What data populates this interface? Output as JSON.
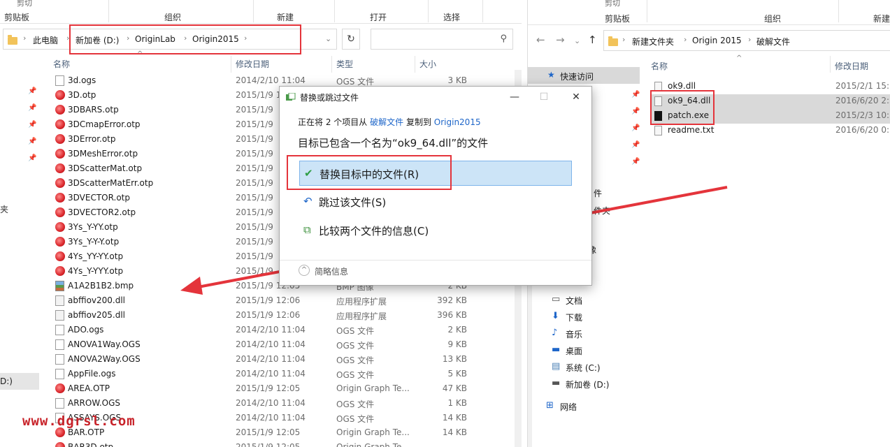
{
  "left": {
    "ribbon": {
      "cut_top": "剪切",
      "groups": [
        "剪贴板",
        "组织",
        "新建",
        "打开",
        "选择"
      ]
    },
    "breadcrumb": [
      "此电脑",
      "新加卷 (D:)",
      "OriginLab",
      "Origin2015"
    ],
    "columns": {
      "name": "名称",
      "date": "修改日期",
      "type": "类型",
      "size": "大小"
    },
    "files": [
      {
        "name": "3d.ogs",
        "date": "2014/2/10 11:04",
        "type": "OGS 文件",
        "size": "3 KB",
        "icon": "doc"
      },
      {
        "name": "3D.otp",
        "date": "2015/1/9 12:05",
        "type": "",
        "size": "",
        "icon": "origin"
      },
      {
        "name": "3DBARS.otp",
        "date": "2015/1/9",
        "type": "",
        "size": "",
        "icon": "origin"
      },
      {
        "name": "3DCmapError.otp",
        "date": "2015/1/9",
        "type": "",
        "size": "",
        "icon": "origin"
      },
      {
        "name": "3DError.otp",
        "date": "2015/1/9",
        "type": "",
        "size": "",
        "icon": "origin"
      },
      {
        "name": "3DMeshError.otp",
        "date": "2015/1/9",
        "type": "",
        "size": "",
        "icon": "origin"
      },
      {
        "name": "3DScatterMat.otp",
        "date": "2015/1/9",
        "type": "",
        "size": "",
        "icon": "origin"
      },
      {
        "name": "3DScatterMatErr.otp",
        "date": "2015/1/9",
        "type": "",
        "size": "",
        "icon": "origin"
      },
      {
        "name": "3DVECTOR.otp",
        "date": "2015/1/9",
        "type": "",
        "size": "",
        "icon": "origin"
      },
      {
        "name": "3DVECTOR2.otp",
        "date": "2015/1/9",
        "type": "",
        "size": "",
        "icon": "origin"
      },
      {
        "name": "3Ys_Y-YY.otp",
        "date": "2015/1/9",
        "type": "",
        "size": "",
        "icon": "origin"
      },
      {
        "name": "3Ys_Y-Y-Y.otp",
        "date": "2015/1/9",
        "type": "",
        "size": "",
        "icon": "origin"
      },
      {
        "name": "4Ys_YY-YY.otp",
        "date": "2015/1/9",
        "type": "",
        "size": "",
        "icon": "origin"
      },
      {
        "name": "4Ys_Y-YYY.otp",
        "date": "2015/1/9",
        "type": "",
        "size": "",
        "icon": "origin"
      },
      {
        "name": "A1A2B1B2.bmp",
        "date": "2015/1/9 12:05",
        "type": "BMP 图像",
        "size": "2 KB",
        "icon": "bmp"
      },
      {
        "name": "abffiov200.dll",
        "date": "2015/1/9 12:06",
        "type": "应用程序扩展",
        "size": "392 KB",
        "icon": "dll"
      },
      {
        "name": "abffiov205.dll",
        "date": "2015/1/9 12:06",
        "type": "应用程序扩展",
        "size": "396 KB",
        "icon": "dll"
      },
      {
        "name": "ADO.ogs",
        "date": "2014/2/10 11:04",
        "type": "OGS 文件",
        "size": "2 KB",
        "icon": "doc"
      },
      {
        "name": "ANOVA1Way.OGS",
        "date": "2014/2/10 11:04",
        "type": "OGS 文件",
        "size": "9 KB",
        "icon": "doc"
      },
      {
        "name": "ANOVA2Way.OGS",
        "date": "2014/2/10 11:04",
        "type": "OGS 文件",
        "size": "13 KB",
        "icon": "doc"
      },
      {
        "name": "AppFile.ogs",
        "date": "2014/2/10 11:04",
        "type": "OGS 文件",
        "size": "5 KB",
        "icon": "doc"
      },
      {
        "name": "AREA.OTP",
        "date": "2015/1/9 12:05",
        "type": "Origin Graph Te...",
        "size": "47 KB",
        "icon": "origin"
      },
      {
        "name": "ARROW.OGS",
        "date": "2014/2/10 11:04",
        "type": "OGS 文件",
        "size": "1 KB",
        "icon": "doc"
      },
      {
        "name": "ASSAYS.OGS",
        "date": "2014/2/10 11:04",
        "type": "OGS 文件",
        "size": "14 KB",
        "icon": "doc"
      },
      {
        "name": "BAR.OTP",
        "date": "2015/1/9 12:05",
        "type": "Origin Graph Te...",
        "size": "14 KB",
        "icon": "origin"
      },
      {
        "name": "BAR3D.otp",
        "date": "2015/1/9 12:05",
        "type": "Origin Graph Te...",
        "size": "",
        "icon": "origin"
      }
    ],
    "side": {
      "folder_partial": "夹",
      "drive_partial": "D:)"
    }
  },
  "right": {
    "ribbon": {
      "cut_top": "剪切",
      "groups": [
        "剪贴板",
        "组织",
        "新建"
      ]
    },
    "breadcrumb": [
      "新建文件夹",
      "Origin 2015",
      "破解文件"
    ],
    "columns": {
      "name": "名称",
      "date": "修改日期"
    },
    "quick_access": "快速访问",
    "side_partials": [
      "件",
      "件夹",
      "像"
    ],
    "nav": [
      "文档",
      "下载",
      "音乐",
      "桌面",
      "系统 (C:)",
      "新加卷 (D:)",
      "网络"
    ],
    "files": [
      {
        "name": "ok9.dll",
        "date": "2015/2/1 15:1",
        "icon": "dll"
      },
      {
        "name": "ok9_64.dll",
        "date": "2016/6/20 2:3",
        "icon": "dll"
      },
      {
        "name": "patch.exe",
        "date": "2015/2/3 10:3",
        "icon": "exe"
      },
      {
        "name": "readme.txt",
        "date": "2016/6/20 0:5",
        "icon": "doc"
      }
    ]
  },
  "dialog": {
    "title": "替换或跳过文件",
    "line1_prefix": "正在将 2 个项目从",
    "line1_src": "破解文件",
    "line1_mid": "复制到",
    "line1_dst": "Origin2015",
    "line2": "目标已包含一个名为“ok9_64.dll”的文件",
    "options": [
      {
        "label": "替换目标中的文件(R)",
        "icon": "check-icon"
      },
      {
        "label": "跳过该文件(S)",
        "icon": "skip-icon"
      },
      {
        "label": "比较两个文件的信息(C)",
        "icon": "compare-icon"
      }
    ],
    "details": "简略信息"
  },
  "watermark": "www.dgrsl.com",
  "colors": {
    "highlight_red": "#e4343b",
    "selection_blue": "#cce4f7",
    "link_blue": "#1e66c9"
  }
}
